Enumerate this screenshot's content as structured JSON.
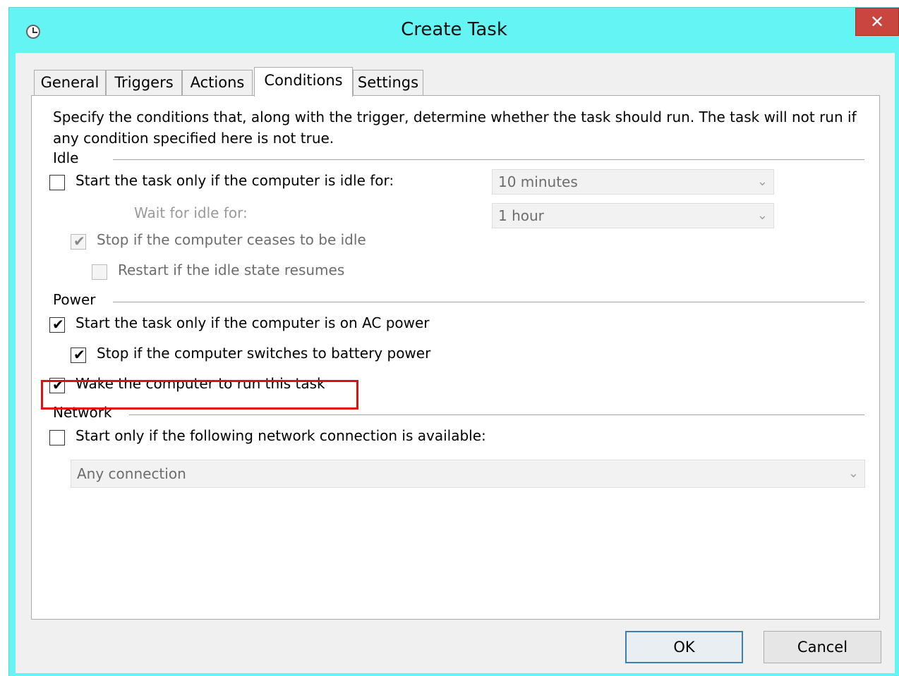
{
  "window": {
    "title": "Create Task",
    "close_glyph": "✕",
    "icon": "clock-icon"
  },
  "tabs": [
    {
      "label": "General",
      "active": false
    },
    {
      "label": "Triggers",
      "active": false
    },
    {
      "label": "Actions",
      "active": false
    },
    {
      "label": "Conditions",
      "active": true
    },
    {
      "label": "Settings",
      "active": false
    }
  ],
  "description": "Specify the conditions that, along with the trigger, determine whether the task should run.  The task will not run  if any condition specified here is not true.",
  "idle": {
    "group_label": "Idle",
    "start_if_idle_label": "Start the task only if the computer is idle for:",
    "start_if_idle_checked": false,
    "idle_for_value": "10 minutes",
    "wait_label": "Wait for idle for:",
    "wait_value": "1 hour",
    "stop_if_ceases_label": "Stop if the computer ceases to be idle",
    "stop_if_ceases_checked": true,
    "restart_label": "Restart if the idle state resumes",
    "restart_checked": false
  },
  "power": {
    "group_label": "Power",
    "ac_power_label": "Start the task only if the computer is on AC power",
    "ac_power_checked": true,
    "battery_label": "Stop if the computer switches to battery power",
    "battery_checked": true,
    "wake_label": "Wake the computer to run this task",
    "wake_checked": true
  },
  "network": {
    "group_label": "Network",
    "start_network_label": "Start only if the following network connection is available:",
    "start_network_checked": false,
    "connection_value": "Any connection"
  },
  "buttons": {
    "ok": "OK",
    "cancel": "Cancel"
  },
  "glyphs": {
    "check": "✔",
    "dropdown": "⌄"
  },
  "colors": {
    "title_bar": "#65f4f4",
    "close": "#c8463d",
    "highlight": "#e01010"
  }
}
